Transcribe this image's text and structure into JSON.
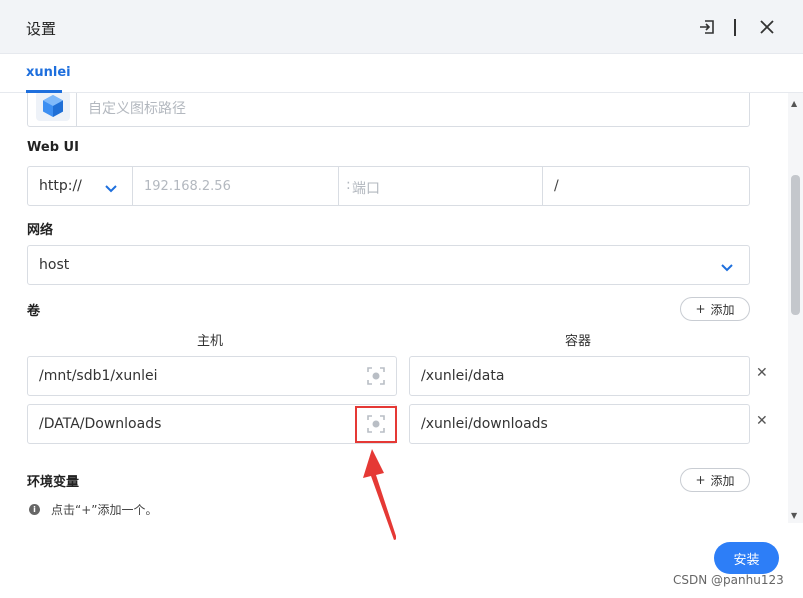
{
  "window": {
    "title": "设置"
  },
  "tabs": [
    {
      "label": "xunlei"
    }
  ],
  "icon_path": {
    "placeholder": "自定义图标路径"
  },
  "webui": {
    "label": "Web UI",
    "protocol": "http://",
    "host_placeholder": "192.168.2.56",
    "port_placeholder": "端口",
    "path_value": "/"
  },
  "network": {
    "label": "网络",
    "value": "host"
  },
  "volumes": {
    "label": "卷",
    "add_label": "添加",
    "col_host": "主机",
    "col_container": "容器",
    "rows": [
      {
        "host": "/mnt/sdb1/xunlei",
        "container": "/xunlei/data"
      },
      {
        "host": "/DATA/Downloads",
        "container": "/xunlei/downloads"
      }
    ]
  },
  "env": {
    "label": "环境变量",
    "add_label": "添加",
    "hint": "点击“+”添加一个。"
  },
  "footer": {
    "install_label": "安装"
  },
  "watermark": "CSDN @panhu123",
  "colors": {
    "accent": "#2d7ef7",
    "tab_active": "#1e6fdd",
    "highlight": "#e53935"
  }
}
